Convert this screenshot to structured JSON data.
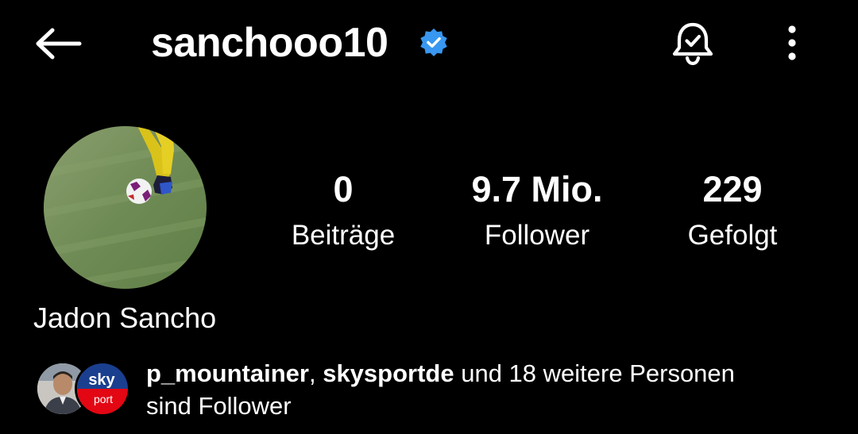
{
  "header": {
    "username": "sanchooo10",
    "icons": [
      "back-arrow-icon",
      "verified-badge-icon",
      "bell-notification-icon",
      "more-vertical-icon"
    ]
  },
  "profile": {
    "full_name": "Jadon Sancho",
    "stats": [
      {
        "value": "0",
        "label": "Beiträge"
      },
      {
        "value": "9.7 Mio.",
        "label": "Follower"
      },
      {
        "value": "229",
        "label": "Gefolgt"
      }
    ]
  },
  "mutual": {
    "user1": "p_mountainer",
    "separator": ", ",
    "user2": "skysportde",
    "rest": " und 18 weitere Personen",
    "line2": "sind Follower",
    "badge_top": "sky",
    "badge_bottom": "port"
  },
  "colors": {
    "background": "#000000",
    "text": "#ffffff",
    "verified": "#3897f0",
    "sky_red": "#e30613"
  }
}
